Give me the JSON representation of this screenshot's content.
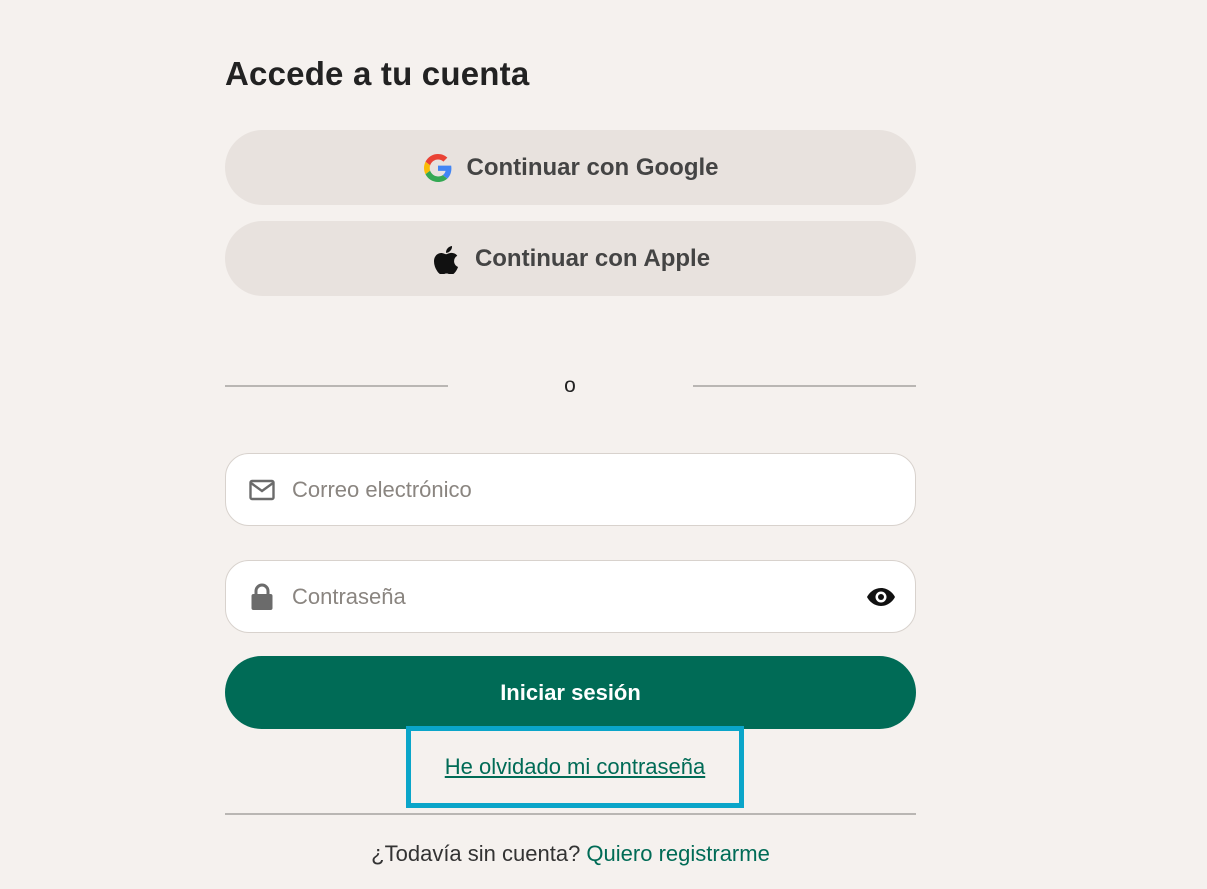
{
  "login": {
    "title": "Accede a tu cuenta",
    "google_label": "Continuar con Google",
    "apple_label": "Continuar con Apple",
    "divider_text": "o",
    "email_placeholder": "Correo electrónico",
    "password_placeholder": "Contraseña",
    "submit_label": "Iniciar sesión",
    "forgot_label": "He olvidado mi contraseña",
    "signup_prompt": "¿Todavía sin cuenta?",
    "signup_link": "Quiero registrarme"
  },
  "icons": {
    "google": "google-logo-icon",
    "apple": "apple-logo-icon",
    "email": "mail-icon",
    "password": "lock-icon",
    "toggle": "eye-icon"
  },
  "colors": {
    "background": "#f5f1ee",
    "primary": "#006b56",
    "social_button": "#e8e2de",
    "highlight_border": "#0aa5c9"
  }
}
